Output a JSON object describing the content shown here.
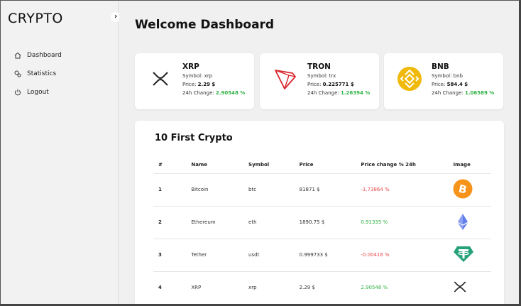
{
  "app": {
    "brand": "CRYPTO",
    "collapse_icon": "chevron-right-icon"
  },
  "sidebar": {
    "items": [
      {
        "label": "Dashboard",
        "icon": "home-icon"
      },
      {
        "label": "Statistics",
        "icon": "statistics-icon"
      },
      {
        "label": "Logout",
        "icon": "power-icon"
      }
    ]
  },
  "header": {
    "title": "Welcome Dashboard"
  },
  "cards": [
    {
      "name": "XRP",
      "symbol_label": "Symbol: ",
      "symbol": "xrp",
      "price_label": "Price: ",
      "price": "2.29 $",
      "change_label": "24h Change: ",
      "change": "2.90548 %",
      "icon": "xrp-logo-icon"
    },
    {
      "name": "TRON",
      "symbol_label": "Symbol: ",
      "symbol": "trx",
      "price_label": "Price: ",
      "price": "0.225771 $",
      "change_label": "24h Change: ",
      "change": "1.26394 %",
      "icon": "tron-logo-icon",
      "color": "#d9252b"
    },
    {
      "name": "BNB",
      "symbol_label": "Symbol: ",
      "symbol": "bnb",
      "price_label": "Price: ",
      "price": "584.4 $",
      "change_label": "24h Change: ",
      "change": "1.06589 %",
      "icon": "bnb-logo-icon",
      "color": "#f0b90b"
    }
  ],
  "table": {
    "title": "10 First Crypto",
    "columns": [
      "#",
      "Name",
      "Symbol",
      "Price",
      "Price change % 24h",
      "Image"
    ],
    "rows": [
      {
        "rank": "1",
        "name": "Bitcoin",
        "symbol": "btc",
        "price": "81871 $",
        "change": "-1.73864 %",
        "trend": "negative",
        "icon": "bitcoin-logo-icon"
      },
      {
        "rank": "2",
        "name": "Ethereum",
        "symbol": "eth",
        "price": "1890.75 $",
        "change": "0.91335 %",
        "trend": "positive",
        "icon": "ethereum-logo-icon"
      },
      {
        "rank": "3",
        "name": "Tether",
        "symbol": "usdt",
        "price": "0.999733 $",
        "change": "-0.00416 %",
        "trend": "negative",
        "icon": "tether-logo-icon"
      },
      {
        "rank": "4",
        "name": "XRP",
        "symbol": "xrp",
        "price": "2.29 $",
        "change": "2.90548 %",
        "trend": "positive",
        "icon": "xrp-logo-icon"
      }
    ]
  },
  "colors": {
    "positive": "#2fb344",
    "negative": "#e5484d",
    "bitcoin": "#f7931a",
    "tether": "#26a17b",
    "ethereum": "#627eea"
  }
}
